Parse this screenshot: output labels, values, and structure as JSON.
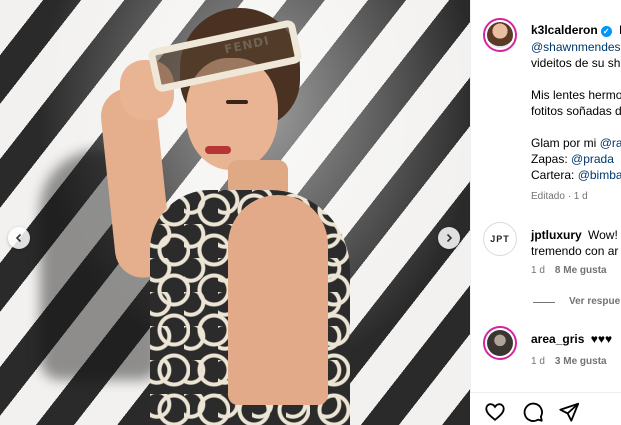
{
  "post": {
    "author": "k3lcalderon",
    "caption_lines": [
      "Lo",
      "@shawnmendes",
      "videitos de su sh",
      "",
      "Mis lentes hermo",
      "fotitos soñadas d",
      "",
      "Glam por mi @ra",
      "Zapas: @prada",
      "Cartera: @bimba"
    ],
    "edited_meta": "Editado · 1 d",
    "photo_glasses_text": "FENDI"
  },
  "comments": [
    {
      "avatar_text": "JPT",
      "username": "jptluxury",
      "text_line1": "Wow! ∧",
      "text_line2": "tremendo con ar",
      "age": "1 d",
      "likes": "8 Me gusta",
      "replies_label": "Ver respue"
    },
    {
      "username": "area_gris",
      "text_line1": "♥♥♥",
      "age": "1 d",
      "likes": "3 Me gusta"
    }
  ],
  "icons": {
    "prev": "chevron-left-icon",
    "next": "chevron-right-icon",
    "like": "heart-icon",
    "comment": "comment-icon",
    "share": "send-icon",
    "verified": "verified-badge-icon"
  },
  "colors": {
    "link": "#00376b",
    "verified": "#0095f6",
    "meta": "#737373",
    "story_ring": "#d6249f"
  }
}
